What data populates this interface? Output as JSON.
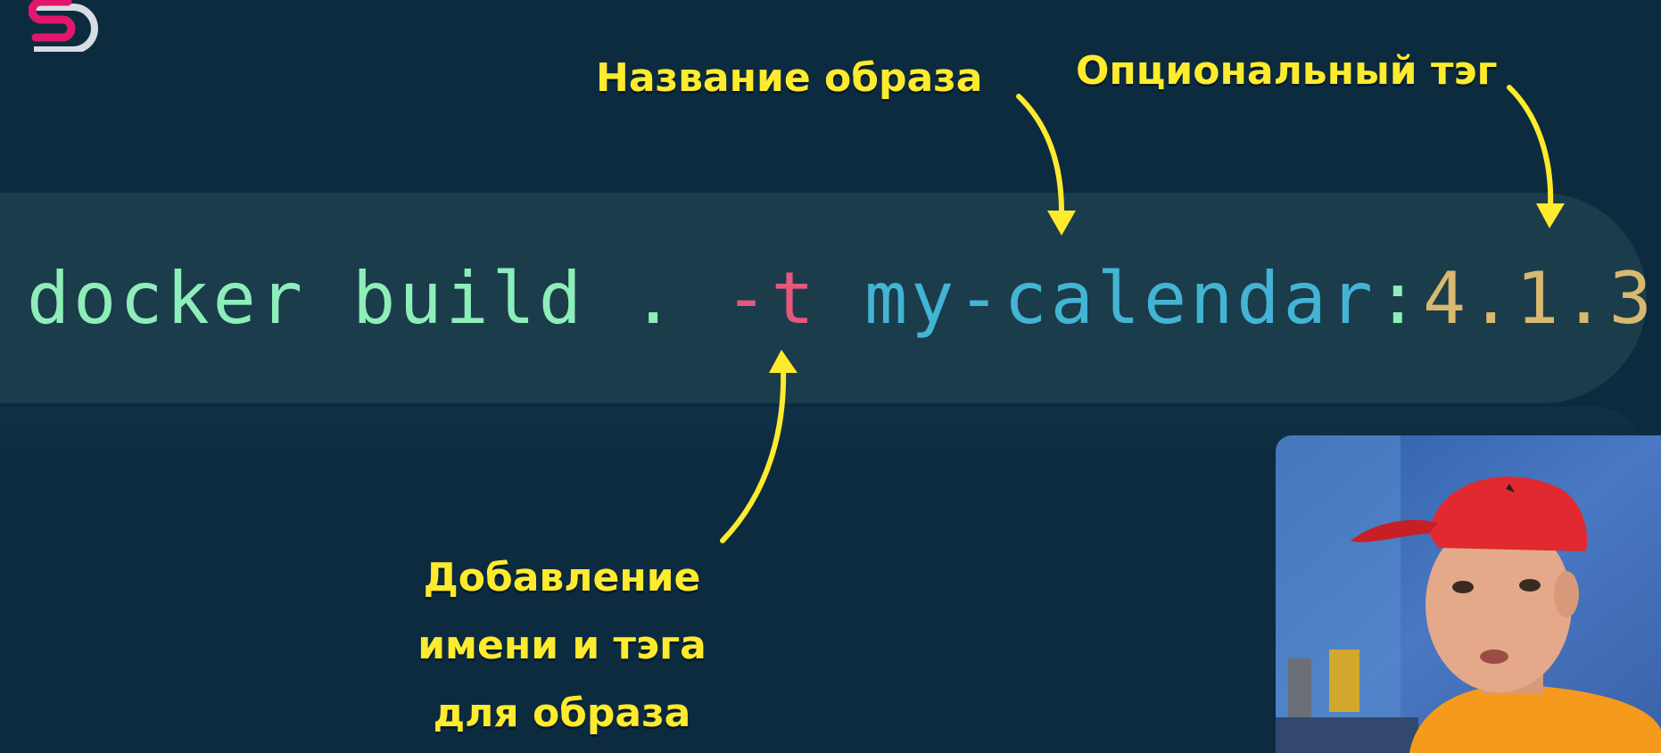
{
  "command": {
    "cmd": "docker build . ",
    "flag": "-t",
    "space": " ",
    "image_name": "my-calendar",
    "colon": ":",
    "tag": "4.1.3"
  },
  "annotations": {
    "image_name": "Название образа",
    "optional_tag": "Опциональный тэг",
    "add_name_tag": [
      "Добавление",
      "имени и тэга",
      "для образа"
    ]
  },
  "icons": {
    "logo": "channel-logo-icon",
    "webcam": "presenter-webcam"
  },
  "colors": {
    "background": "#0c2b3f",
    "command_bar": "#1b3c4b",
    "command_text": "#8eeeb9",
    "flag_text": "#e5577c",
    "name_text": "#43b4d4",
    "tag_text": "#d9b870",
    "annotation": "#ffeb2e"
  }
}
